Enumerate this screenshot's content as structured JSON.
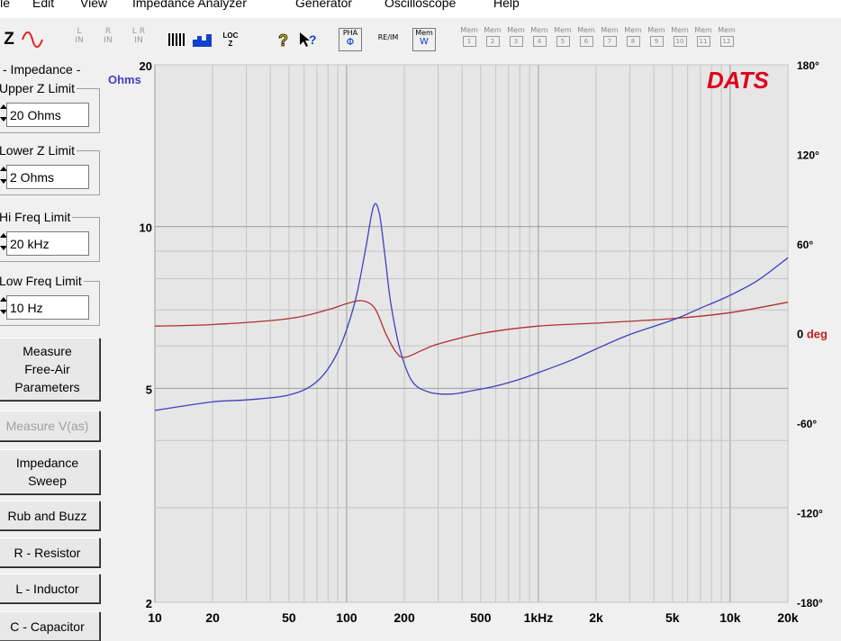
{
  "menu": [
    "ile",
    "Edit",
    "View",
    "Impedance Analyzer",
    "Generator",
    "Oscilloscope",
    "Help"
  ],
  "toolbar": {
    "z_label": "Z",
    "input_buttons": [
      {
        "top": "L",
        "bottom": "IN"
      },
      {
        "top": "R",
        "bottom": "IN"
      },
      {
        "top": "L R",
        "bottom": "IN"
      }
    ],
    "loc_label": "LOC",
    "pha_label": "PHA",
    "re_label": "RE/IM",
    "mem_w_label": "Mem W",
    "mem_label": "Mem",
    "mem_slots": [
      "1",
      "2",
      "3",
      "4",
      "5",
      "6",
      "7",
      "8",
      "9",
      "10",
      "11",
      "12"
    ]
  },
  "panel": {
    "section_title": "- Impedance -",
    "upper_z": {
      "label": "Upper Z Limit",
      "value": "20 Ohms"
    },
    "lower_z": {
      "label": "Lower Z Limit",
      "value": "2 Ohms"
    },
    "hi_freq": {
      "label": "Hi Freq Limit",
      "value": "20 kHz"
    },
    "low_freq": {
      "label": "Low Freq Limit",
      "value": "10 Hz"
    },
    "buttons": {
      "measure_free_air": [
        "Measure",
        "Free-Air",
        "Parameters"
      ],
      "measure_vas": "Measure V(as)",
      "impedance_sweep": [
        "Impedance",
        "Sweep"
      ],
      "rub_buzz": "Rub and Buzz",
      "resistor": "R - Resistor",
      "inductor": "L - Inductor",
      "capacitor": "C - Capacitor"
    }
  },
  "chart_data": {
    "type": "line",
    "brand": "DATS",
    "y_left_unit": "Ohms",
    "y_right_unit": "deg",
    "x_scale": "log",
    "y_scale": "log",
    "xlim": [
      10,
      20000
    ],
    "ylim": [
      2,
      20
    ],
    "y2lim": [
      -180,
      180
    ],
    "x_ticks": [
      {
        "v": 10,
        "label": "10"
      },
      {
        "v": 20,
        "label": "20"
      },
      {
        "v": 50,
        "label": "50"
      },
      {
        "v": 100,
        "label": "100"
      },
      {
        "v": 200,
        "label": "200"
      },
      {
        "v": 500,
        "label": "500"
      },
      {
        "v": 1000,
        "label": "1kHz"
      },
      {
        "v": 2000,
        "label": "2k"
      },
      {
        "v": 5000,
        "label": "5k"
      },
      {
        "v": 10000,
        "label": "10k"
      },
      {
        "v": 20000,
        "label": "20k"
      }
    ],
    "y_ticks": [
      {
        "v": 20,
        "label": "20"
      },
      {
        "v": 10,
        "label": "10"
      },
      {
        "v": 5,
        "label": "5"
      },
      {
        "v": 2,
        "label": "2"
      }
    ],
    "y2_ticks": [
      {
        "v": 180,
        "label": "180°"
      },
      {
        "v": 120,
        "label": "120°"
      },
      {
        "v": 60,
        "label": "60°"
      },
      {
        "v": 0,
        "label": "0"
      },
      {
        "v": -60,
        "label": "-60°"
      },
      {
        "v": -120,
        "label": "-120°"
      },
      {
        "v": -180,
        "label": "-180°"
      }
    ],
    "grid": true,
    "colors": {
      "impedance": "#3f3fbf",
      "phase": "#b03030",
      "brand": "#e0001b",
      "ohms_label": "#4040c0",
      "deg_label": "#c02020",
      "background": "#e6e6e6"
    },
    "series": [
      {
        "name": "Impedance",
        "x": [
          10,
          20,
          30,
          50,
          70,
          90,
          110,
          125,
          138,
          148,
          158,
          170,
          190,
          220,
          270,
          350,
          450,
          600,
          800,
          1000,
          1200,
          1500,
          2000,
          3000,
          5000,
          7000,
          10000,
          14000,
          20000
        ],
        "y": [
          4.55,
          4.72,
          4.76,
          4.86,
          5.15,
          5.85,
          7.2,
          9.0,
          10.9,
          10.6,
          8.9,
          7.2,
          5.9,
          5.15,
          4.92,
          4.88,
          4.95,
          5.05,
          5.2,
          5.35,
          5.48,
          5.65,
          5.92,
          6.3,
          6.7,
          7.05,
          7.45,
          7.95,
          8.75
        ]
      },
      {
        "name": "Phase",
        "x": [
          10,
          20,
          50,
          80,
          100,
          120,
          140,
          160,
          180,
          200,
          250,
          300,
          500,
          1000,
          2000,
          5000,
          10000,
          20000
        ],
        "y": [
          5,
          6,
          10,
          16,
          20,
          22,
          17,
          0,
          -12,
          -16,
          -11,
          -7,
          0,
          5,
          7,
          10,
          14,
          21
        ]
      }
    ]
  }
}
